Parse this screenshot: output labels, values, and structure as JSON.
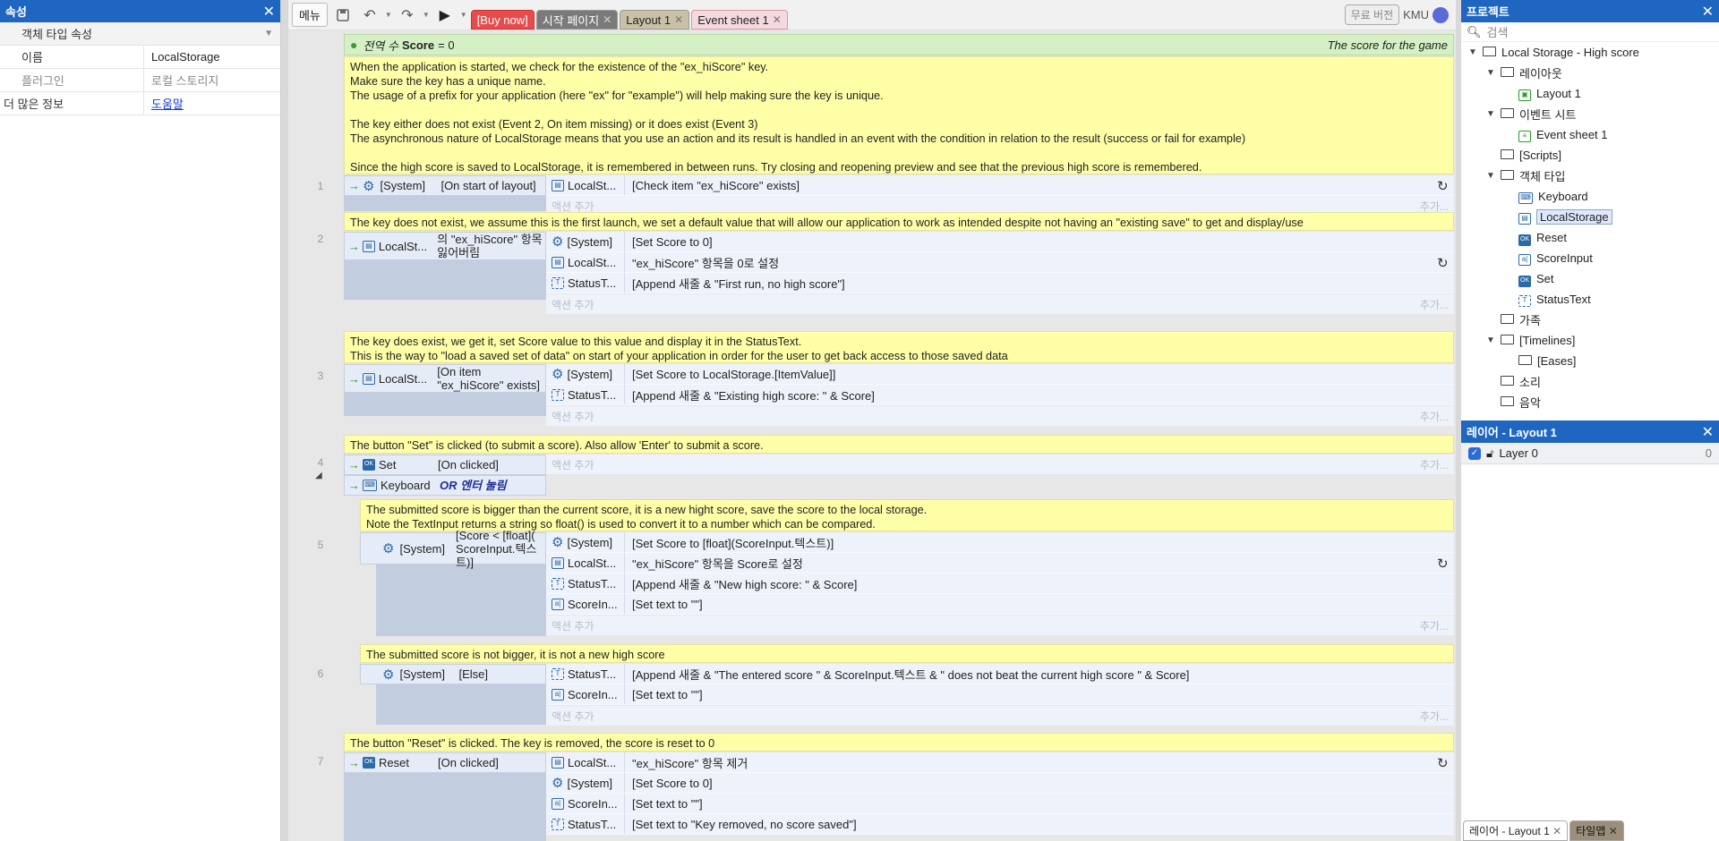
{
  "left_panel": {
    "title": "속성",
    "section": "객체 타입 속성",
    "rows": [
      {
        "key": "이름",
        "value": "LocalStorage"
      },
      {
        "key": "플러그인",
        "value": "로컬 스토리지"
      }
    ],
    "more_info_label": "더 많은 정보",
    "help_link": "도움말"
  },
  "toolbar": {
    "menu": "메뉴",
    "tabs": [
      {
        "label": "[Buy now]"
      },
      {
        "label": "시작 페이지"
      },
      {
        "label": "Layout 1"
      },
      {
        "label": "Event sheet 1"
      }
    ],
    "free_version": "무료 버전",
    "user": "KMU"
  },
  "sheet": {
    "global": {
      "prefix": "전역 수",
      "name": "Score",
      "value": "= 0",
      "comment": "The score for the game"
    },
    "intro_comment": "When the application is started, we check for the existence of the \"ex_hiScore\" key.\nMake sure the key has a unique name.\nThe usage of a prefix for your application (here \"ex\" for \"example\") will help making sure the key is unique.\n\nThe key either does not exist (Event 2, On item missing) or it does exist (Event 3)\nThe asynchronous nature of LocalStorage means that you use an action and its result is handled in an event with the condition in relation to the result (success or fail for example)\n\nSince the high score is saved to LocalStorage, it is remembered in between runs. Try closing and reopening preview and see that the previous high score is remembered.",
    "add_action": "액션 추가",
    "add_more": "추가...",
    "events": [
      {
        "num": "1",
        "comment": "",
        "conditions": [
          {
            "obj": "[System]",
            "text": "[On start of layout]"
          }
        ],
        "actions": [
          {
            "obj": "LocalSt...",
            "text": "[Check item \"ex_hiScore\" exists]"
          }
        ]
      },
      {
        "num": "2",
        "comment": "The key does not exist, we assume this is the first launch, we set a default value that will allow our application to work as intended despite not having an \"existing save\" to get and display/use",
        "conditions": [
          {
            "obj": "LocalSt...",
            "text": "의 \"ex_hiScore\" 항목 잃어버림"
          }
        ],
        "actions": [
          {
            "obj": "[System]",
            "text": "[Set Score to 0]"
          },
          {
            "obj": "LocalSt...",
            "text": "\"ex_hiScore\" 항목을 0로 설정"
          },
          {
            "obj": "StatusT...",
            "text": "[Append 새줄 & \"First run, no high score\"]"
          }
        ]
      },
      {
        "num": "3",
        "comment": "The key does exist, we get it, set Score value to this value and display it in the StatusText.\nThis is the way to \"load a saved set of data\" on start of your application in order for the user to get back access to those saved data",
        "conditions": [
          {
            "obj": "LocalSt...",
            "text": "[On item \"ex_hiScore\" exists]"
          }
        ],
        "actions": [
          {
            "obj": "[System]",
            "text": "[Set Score to LocalStorage.[ItemValue]]"
          },
          {
            "obj": "StatusT...",
            "text": "[Append 새줄 & \"Existing high score: \" & Score]"
          }
        ]
      },
      {
        "num": "4",
        "comment": "The button \"Set\" is clicked (to submit a score). Also allow 'Enter' to submit a score.",
        "conditions": [
          {
            "obj": "Set",
            "text": "[On clicked]"
          },
          {
            "obj": "Keyboard",
            "text": "OR 엔터 눌림"
          }
        ],
        "actions": []
      },
      {
        "num": "5",
        "comment": "The submitted score is bigger than the current score, it is a new hight score, save the score to the local storage.\nNote the TextInput returns a string so float() is used to convert it to a number which can be compared.",
        "conditions": [
          {
            "obj": "[System]",
            "text": "[Score < [float]( ScoreInput.텍스트)]"
          }
        ],
        "actions": [
          {
            "obj": "[System]",
            "text": "[Set Score to [float](ScoreInput.텍스트)]"
          },
          {
            "obj": "LocalSt...",
            "text": "\"ex_hiScore\" 항목을 Score로 설정"
          },
          {
            "obj": "StatusT...",
            "text": "[Append 새줄 & \"New high score: \" & Score]"
          },
          {
            "obj": "ScoreIn...",
            "text": "[Set text to \"\"]"
          }
        ]
      },
      {
        "num": "6",
        "comment": "The submitted score is not bigger, it is not a new high score",
        "conditions": [
          {
            "obj": "[System]",
            "text": "[Else]"
          }
        ],
        "actions": [
          {
            "obj": "StatusT...",
            "text": "[Append 새줄 & \"The entered score \" & ScoreInput.텍스트 & \" does not beat the current high score \" & Score]"
          },
          {
            "obj": "ScoreIn...",
            "text": "[Set text to \"\"]"
          }
        ]
      },
      {
        "num": "7",
        "comment": "The button \"Reset\" is clicked. The key is removed, the score is reset to 0",
        "conditions": [
          {
            "obj": "Reset",
            "text": "[On clicked]"
          }
        ],
        "actions": [
          {
            "obj": "LocalSt...",
            "text": "\"ex_hiScore\" 항목 제거"
          },
          {
            "obj": "[System]",
            "text": "[Set Score to 0]"
          },
          {
            "obj": "ScoreIn...",
            "text": "[Set text to \"\"]"
          },
          {
            "obj": "StatusT...",
            "text": "[Set text to \"Key removed, no score saved\"]"
          }
        ]
      }
    ]
  },
  "project": {
    "title": "프로젝트",
    "search": "검색",
    "tree": [
      {
        "label": "Local Storage - High score",
        "depth": 0,
        "tri": "▼",
        "icon": "folder"
      },
      {
        "label": "레이아웃",
        "depth": 1,
        "tri": "▼",
        "icon": "folder"
      },
      {
        "label": "Layout 1",
        "depth": 2,
        "tri": "",
        "icon": "layout"
      },
      {
        "label": "이벤트 시트",
        "depth": 1,
        "tri": "▼",
        "icon": "folder"
      },
      {
        "label": "Event sheet 1",
        "depth": 2,
        "tri": "",
        "icon": "sheet"
      },
      {
        "label": "[Scripts]",
        "depth": 1,
        "tri": "",
        "icon": "folder"
      },
      {
        "label": "객체 타입",
        "depth": 1,
        "tri": "▼",
        "icon": "folder"
      },
      {
        "label": "Keyboard",
        "depth": 2,
        "tri": "",
        "icon": "keyboard"
      },
      {
        "label": "LocalStorage",
        "depth": 2,
        "tri": "",
        "icon": "storage"
      },
      {
        "label": "Reset",
        "depth": 2,
        "tri": "",
        "icon": "button"
      },
      {
        "label": "ScoreInput",
        "depth": 2,
        "tri": "",
        "icon": "textinput"
      },
      {
        "label": "Set",
        "depth": 2,
        "tri": "",
        "icon": "button"
      },
      {
        "label": "StatusText",
        "depth": 2,
        "tri": "",
        "icon": "text"
      },
      {
        "label": "가족",
        "depth": 1,
        "tri": "",
        "icon": "folder"
      },
      {
        "label": "[Timelines]",
        "depth": 1,
        "tri": "▼",
        "icon": "folder"
      },
      {
        "label": "[Eases]",
        "depth": 2,
        "tri": "",
        "icon": "folder"
      },
      {
        "label": "소리",
        "depth": 1,
        "tri": "",
        "icon": "folder"
      },
      {
        "label": "음악",
        "depth": 1,
        "tri": "",
        "icon": "folder"
      }
    ]
  },
  "layers": {
    "title": "레이어 - Layout 1",
    "rows": [
      {
        "name": "Layer 0",
        "count": "0"
      }
    ]
  },
  "bottom_tabs": [
    "레이어 - Layout 1",
    "타일맵"
  ]
}
